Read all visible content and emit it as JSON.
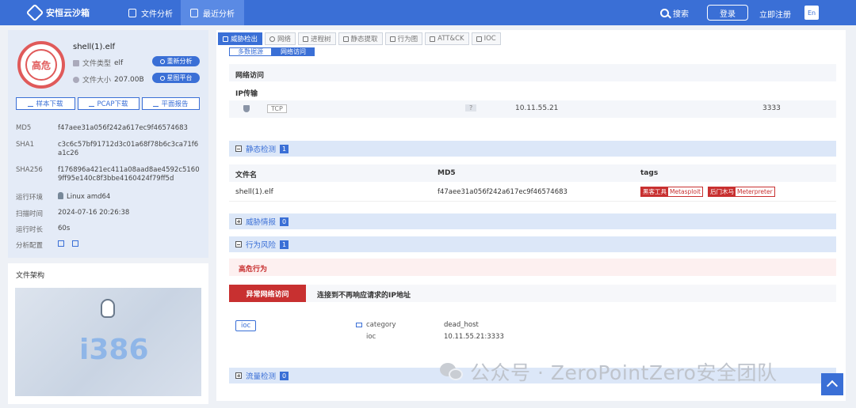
{
  "nav": {
    "brand": "安恒云沙箱",
    "items": [
      {
        "label": "文件分析",
        "icon": "file-icon"
      },
      {
        "label": "最近分析",
        "icon": "clock-icon"
      }
    ],
    "search": "搜索",
    "login": "登录",
    "register": "立即注册",
    "lang": "En"
  },
  "summary": {
    "risk_level": "高危",
    "filename": "shell(1).elf",
    "type_label": "文件类型",
    "type_value": "elf",
    "size_label": "文件大小",
    "size_value": "207.00B",
    "reanalyze": "重新分析",
    "platform": "星图平台",
    "download_sample": "样本下载",
    "download_pcap": "PCAP下载",
    "flat_report": "平面报告",
    "fields": [
      {
        "k": "MD5",
        "v": "f47aee31a056f242a617ec9f46574683"
      },
      {
        "k": "SHA1",
        "v": "c3c6c57bf91712d3c01a68f78b6c3ca71f6a1c26"
      },
      {
        "k": "SHA256",
        "v": "f176896a421ec411a08aad8ae4592c51609ff95e140c8f3bbe4160424f79ff5d"
      },
      {
        "k": "运行环境",
        "v": "Linux amd64"
      },
      {
        "k": "扫描时间",
        "v": "2024-07-16 20:26:38"
      },
      {
        "k": "运行时长",
        "v": "60s"
      },
      {
        "k": "分析配置",
        "v": ""
      }
    ]
  },
  "arch": {
    "title": "文件架构",
    "value": "i386"
  },
  "tabs": [
    "威胁检出",
    "网络",
    "进程树",
    "静态提取",
    "行为图",
    "ATT&CK",
    "IOC"
  ],
  "subtabs": [
    "多数据源",
    "网络访问"
  ],
  "network": {
    "title": "网络访问",
    "ip_title": "IP传输",
    "row": {
      "proto": "TCP",
      "flag": "?",
      "ip": "10.11.55.21",
      "port": "3333"
    }
  },
  "static_check": {
    "title": "静态检测",
    "count": "1",
    "headers": [
      "文件名",
      "MD5",
      "tags"
    ],
    "row": {
      "name": "shell(1).elf",
      "md5": "f47aee31a056f242a617ec9f46574683",
      "tags": [
        {
          "cat": "黑客工具",
          "name": "Metasploit"
        },
        {
          "cat": "后门木马",
          "name": "Meterpreter"
        }
      ]
    }
  },
  "threat_intel": {
    "title": "威胁情报",
    "count": "0"
  },
  "behavior": {
    "title": "行为风险",
    "count": "1",
    "level": "高危行为",
    "item_tag": "异常网络访问",
    "item_desc": "连接到不再响应请求的IP地址",
    "ioc_label": "ioc",
    "kv": [
      {
        "k": "category",
        "v": "dead_host"
      },
      {
        "k": "ioc",
        "v": "10.11.55.21:3333"
      }
    ]
  },
  "traffic": {
    "title": "流量检测",
    "count": "0"
  },
  "watermark": "公众号 · ZeroPointZero安全团队",
  "colors": {
    "primary": "#3a6fd6",
    "danger": "#c83030",
    "section": "#dce7f8"
  }
}
